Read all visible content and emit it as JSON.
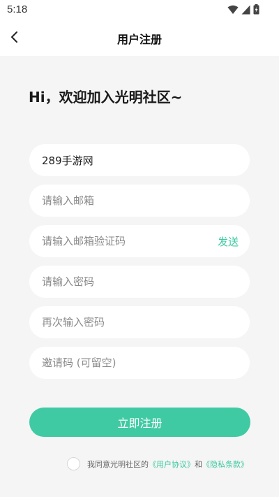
{
  "status": {
    "time": "5:18"
  },
  "header": {
    "title": "用户注册"
  },
  "main": {
    "greeting": "Hi，欢迎加入光明社区~",
    "username_value": "289手游网",
    "email_placeholder": "请输入邮箱",
    "code_placeholder": "请输入邮箱验证码",
    "send_label": "发送",
    "password_placeholder": "请输入密码",
    "confirm_placeholder": "再次输入密码",
    "invite_placeholder": "邀请码 (可留空)",
    "register_label": "立即注册"
  },
  "agreement": {
    "prefix": "我同意光明社区的",
    "user_agreement": "《用户协议》",
    "and": "和",
    "privacy": "《隐私条款》"
  },
  "colors": {
    "accent": "#40caa4",
    "background": "#f5f5f5"
  },
  "icons": [
    "wifi-icon",
    "signal-icon",
    "battery-icon",
    "back-arrow-icon"
  ]
}
